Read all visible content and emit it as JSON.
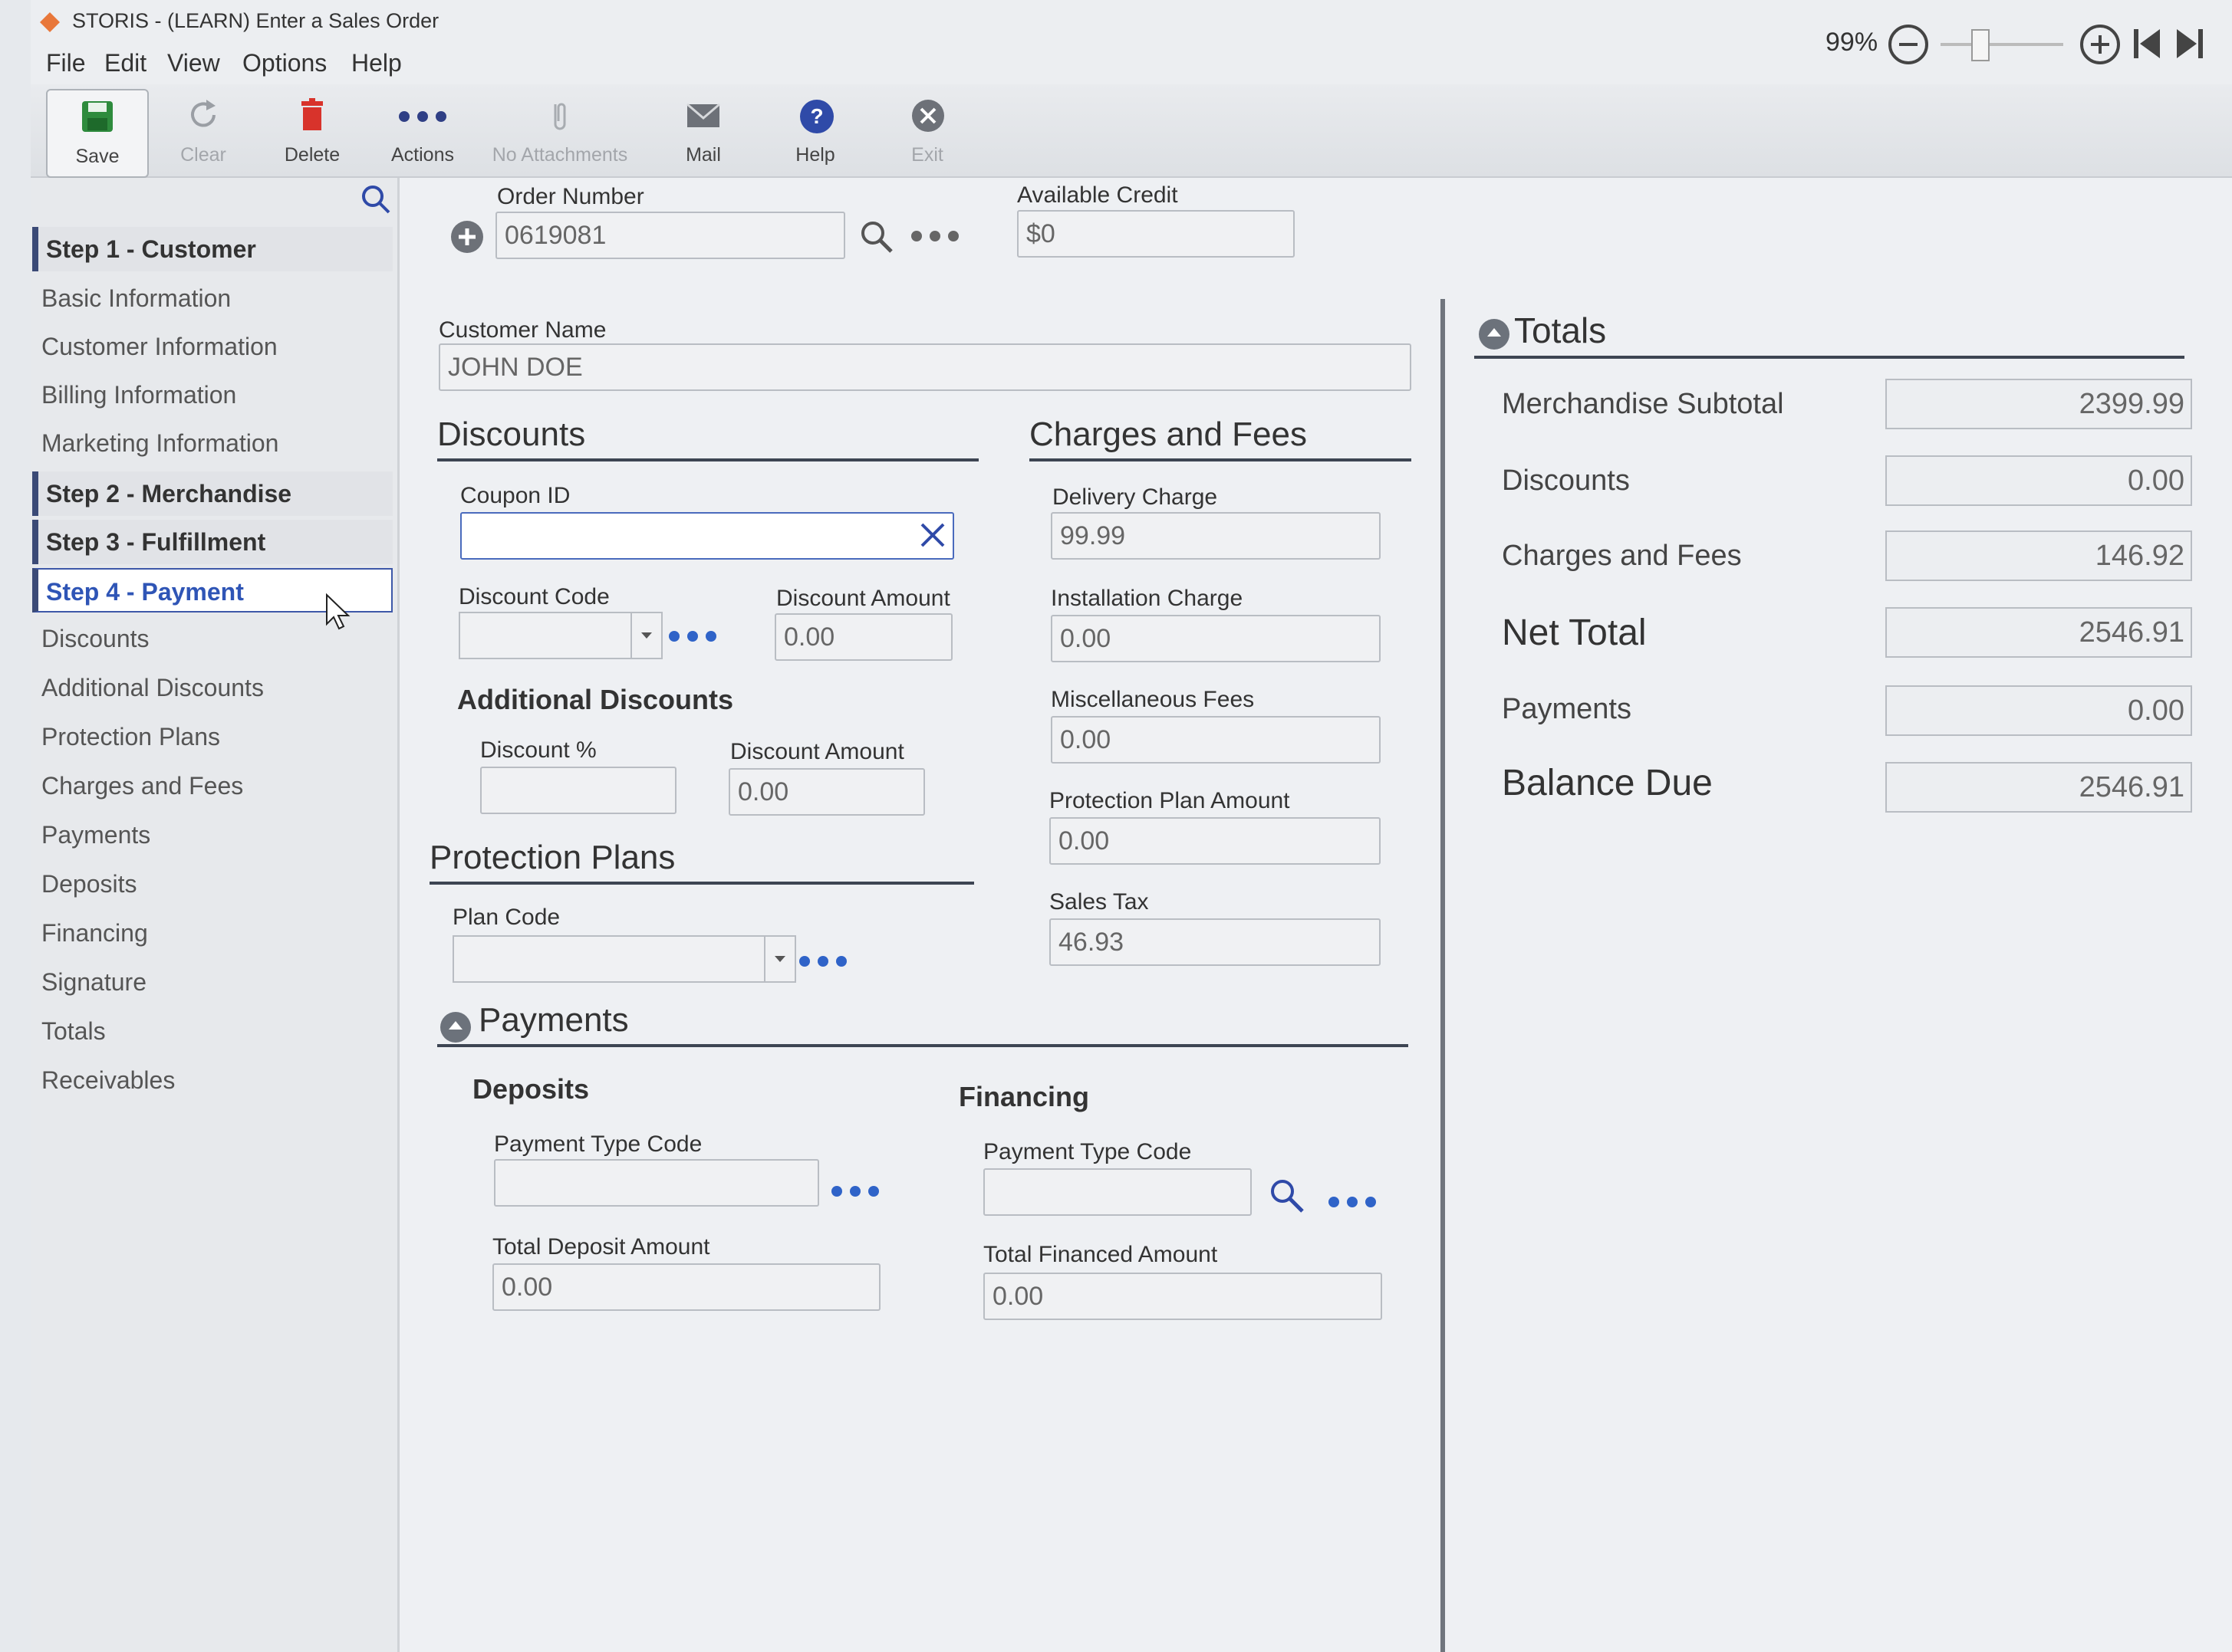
{
  "window": {
    "title": "STORIS - (LEARN) Enter a Sales Order",
    "zoom": "99%"
  },
  "menu": [
    "File",
    "Edit",
    "View",
    "Options",
    "Help"
  ],
  "toolbar": {
    "save": "Save",
    "clear": "Clear",
    "delete": "Delete",
    "actions": "Actions",
    "attachments": "No Attachments",
    "mail": "Mail",
    "help": "Help",
    "exit": "Exit"
  },
  "sidebar": {
    "step1": "Step 1 - Customer",
    "step1_items": [
      "Basic Information",
      "Customer Information",
      "Billing Information",
      "Marketing Information"
    ],
    "step2": "Step 2 - Merchandise",
    "step3": "Step 3 - Fulfillment",
    "step4": "Step 4 - Payment",
    "step4_items": [
      "Discounts",
      "Additional Discounts",
      "Protection Plans",
      "Charges and Fees",
      "Payments",
      "Deposits",
      "Financing",
      "Signature",
      "Totals",
      "Receivables"
    ]
  },
  "header": {
    "order_number_label": "Order Number",
    "order_number": "0619081",
    "available_credit_label": "Available Credit",
    "available_credit": "$0"
  },
  "customer": {
    "label": "Customer Name",
    "value": "JOHN DOE"
  },
  "discounts": {
    "title": "Discounts",
    "coupon_label": "Coupon ID",
    "coupon_value": "",
    "code_label": "Discount Code",
    "amount_label": "Discount Amount",
    "amount": "0.00"
  },
  "additional_discounts": {
    "title": "Additional Discounts",
    "pct_label": "Discount %",
    "pct_value": "",
    "amount_label": "Discount Amount",
    "amount": "0.00"
  },
  "protection": {
    "title": "Protection Plans",
    "plan_code_label": "Plan Code"
  },
  "charges": {
    "title": "Charges and Fees",
    "delivery_label": "Delivery Charge",
    "delivery": "99.99",
    "installation_label": "Installation Charge",
    "installation": "0.00",
    "misc_label": "Miscellaneous Fees",
    "misc": "0.00",
    "protection_label": "Protection Plan Amount",
    "protection": "0.00",
    "tax_label": "Sales Tax",
    "tax": "46.93"
  },
  "payments": {
    "title": "Payments",
    "deposits_title": "Deposits",
    "dep_type_label": "Payment Type Code",
    "dep_total_label": "Total Deposit Amount",
    "dep_total": "0.00",
    "financing_title": "Financing",
    "fin_type_label": "Payment Type Code",
    "fin_total_label": "Total Financed Amount",
    "fin_total": "0.00"
  },
  "totals": {
    "title": "Totals",
    "merch_label": "Merchandise Subtotal",
    "merch": "2399.99",
    "disc_label": "Discounts",
    "disc": "0.00",
    "charges_label": "Charges and Fees",
    "charges": "146.92",
    "net_label": "Net Total",
    "net": "2546.91",
    "pay_label": "Payments",
    "pay": "0.00",
    "balance_label": "Balance Due",
    "balance": "2546.91"
  }
}
